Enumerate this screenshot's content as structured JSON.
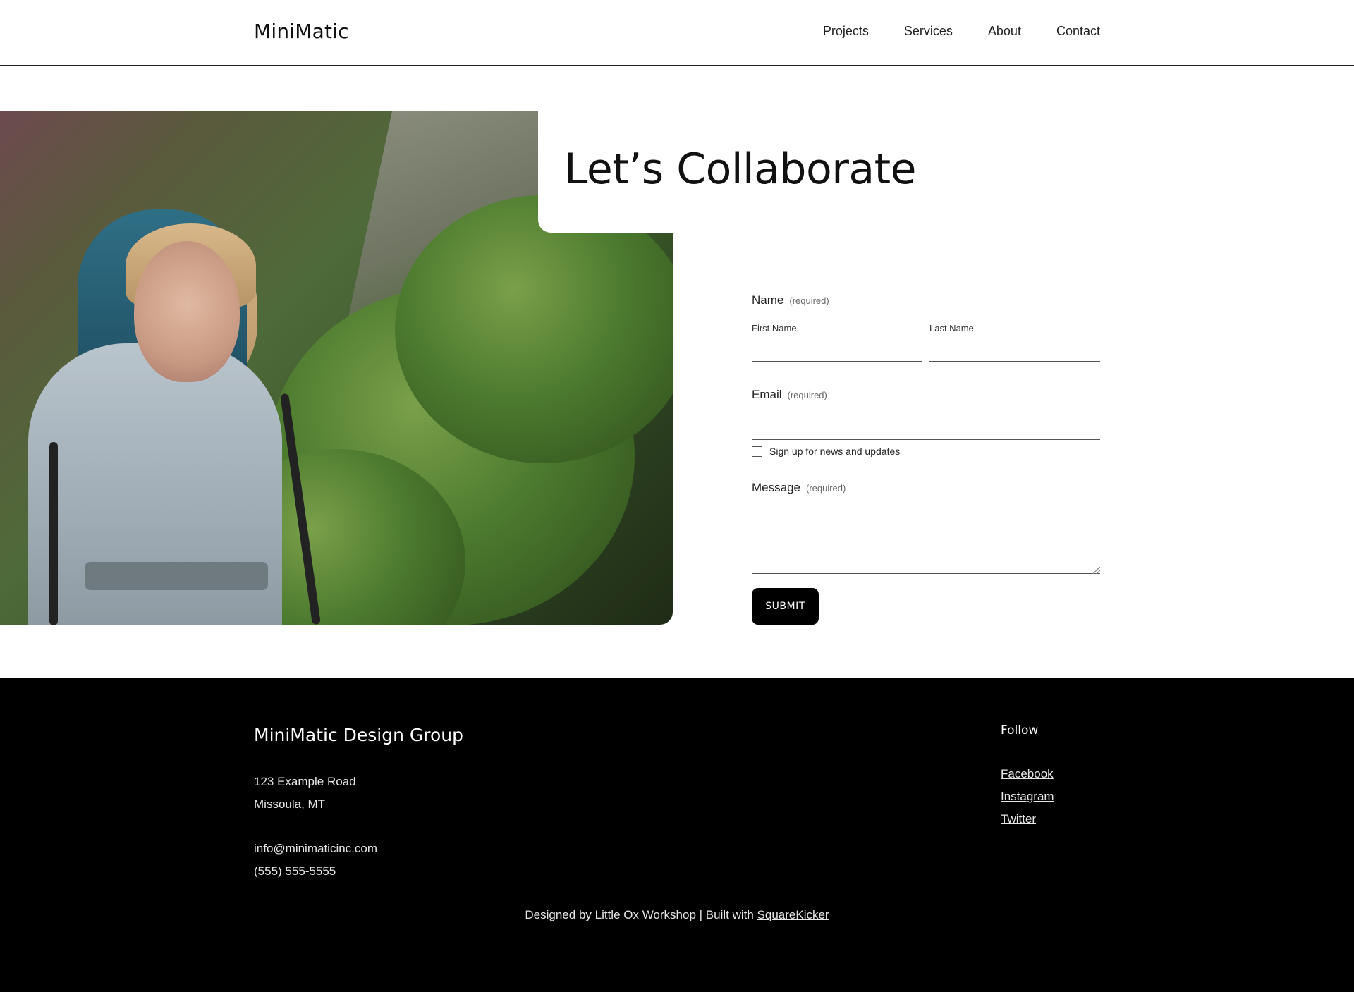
{
  "header": {
    "logo": "MiniMatic",
    "nav": [
      "Projects",
      "Services",
      "About",
      "Contact"
    ]
  },
  "hero": {
    "title": "Let’s Collaborate"
  },
  "form": {
    "name_label": "Name",
    "name_required": "(required)",
    "first_name_label": "First Name",
    "last_name_label": "Last Name",
    "email_label": "Email",
    "email_required": "(required)",
    "newsletter_label": "Sign up for news and updates",
    "newsletter_checked": false,
    "message_label": "Message",
    "message_required": "(required)",
    "submit_label": "SUBMIT"
  },
  "footer": {
    "brand": "MiniMatic Design Group",
    "address_line1": "123 Example Road",
    "address_line2": "Missoula, MT",
    "email": "info@minimaticinc.com",
    "phone": "(555) 555-5555",
    "follow_title": "Follow",
    "social": [
      "Facebook",
      "Instagram",
      "Twitter"
    ],
    "credits_text": "Designed by Little Ox Workshop | Built with ",
    "credits_link": "SquareKicker"
  },
  "colors": {
    "background": "#ffffff",
    "footer_background": "#000000",
    "button": "#000000",
    "text": "#111111"
  },
  "icons": {
    "checkbox": "checkbox-icon",
    "resize": "resize-handle-icon"
  }
}
